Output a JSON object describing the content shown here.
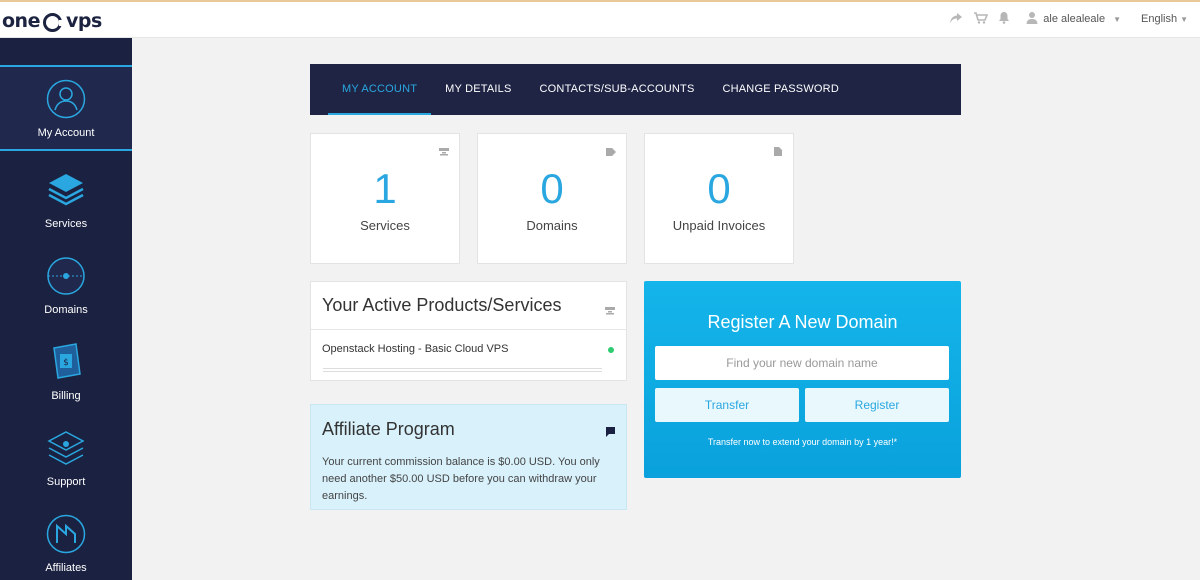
{
  "header": {
    "logo_left": "one",
    "logo_right": "vps",
    "username": "ale alealeale",
    "language": "English",
    "icons": [
      "share-icon",
      "cart-icon",
      "bell-icon",
      "user-icon"
    ]
  },
  "sidebar": {
    "items": [
      {
        "label": "My Account",
        "icon": "account-icon",
        "active": true
      },
      {
        "label": "Services",
        "icon": "services-stack-icon"
      },
      {
        "label": "Domains",
        "icon": "domains-globe-icon"
      },
      {
        "label": "Billing",
        "icon": "billing-icon"
      },
      {
        "label": "Support",
        "icon": "support-icon"
      },
      {
        "label": "Affiliates",
        "icon": "affiliates-icon"
      }
    ]
  },
  "tabs": [
    {
      "label": "MY ACCOUNT",
      "active": true
    },
    {
      "label": "MY DETAILS"
    },
    {
      "label": "CONTACTS/SUB-ACCOUNTS"
    },
    {
      "label": "CHANGE PASSWORD"
    }
  ],
  "stats": [
    {
      "value": "1",
      "label": "Services",
      "icon": "server-icon"
    },
    {
      "value": "0",
      "label": "Domains",
      "icon": "tag-icon"
    },
    {
      "value": "0",
      "label": "Unpaid Invoices",
      "icon": "document-icon"
    }
  ],
  "products": {
    "title": "Your Active Products/Services",
    "items": [
      {
        "name": "Openstack Hosting - Basic Cloud VPS",
        "status_color": "#2ecc71"
      }
    ]
  },
  "affiliate": {
    "title": "Affiliate Program",
    "text": "Your current commission balance is $0.00 USD. You only need another $50.00 USD before you can withdraw your earnings."
  },
  "register": {
    "title": "Register A New Domain",
    "placeholder": "Find your new domain name",
    "transfer_label": "Transfer",
    "register_label": "Register",
    "note": "Transfer now to extend your domain by 1 year!*"
  },
  "colors": {
    "accent": "#2aa7e0",
    "sidebar": "#1b2241",
    "tabbar": "#1f2445",
    "status_ok": "#2ecc71"
  }
}
